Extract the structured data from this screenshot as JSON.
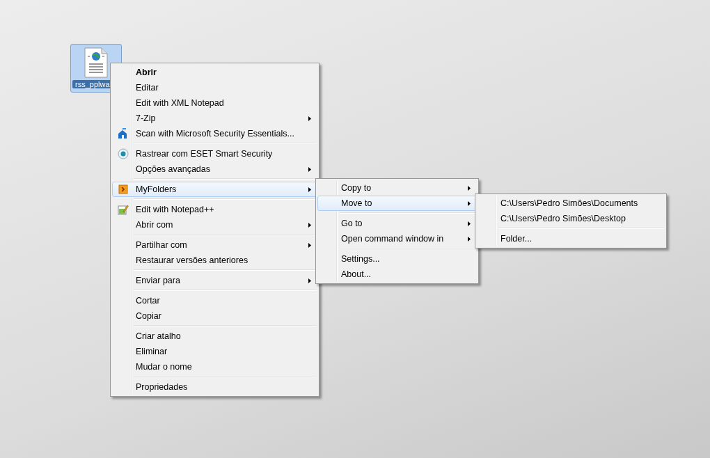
{
  "desktop": {
    "icon": {
      "label": "rss_pplwa",
      "selected": true
    }
  },
  "context_menu": {
    "items": [
      {
        "kind": "item",
        "label": "Abrir",
        "default": true,
        "submenu": false,
        "selected": false
      },
      {
        "kind": "item",
        "label": "Editar",
        "default": false,
        "submenu": false,
        "selected": false
      },
      {
        "kind": "item",
        "label": "Edit with XML Notepad",
        "default": false,
        "submenu": false,
        "selected": false
      },
      {
        "kind": "item",
        "label": "7-Zip",
        "default": false,
        "submenu": true,
        "selected": false
      },
      {
        "kind": "item",
        "label": "Scan with Microsoft Security Essentials...",
        "default": false,
        "submenu": false,
        "selected": false
      },
      {
        "kind": "separator"
      },
      {
        "kind": "item",
        "label": "Rastrear com ESET Smart Security",
        "default": false,
        "submenu": false,
        "selected": false
      },
      {
        "kind": "item",
        "label": "Opções avançadas",
        "default": false,
        "submenu": true,
        "selected": false
      },
      {
        "kind": "separator"
      },
      {
        "kind": "item",
        "label": "MyFolders",
        "default": false,
        "submenu": true,
        "selected": true
      },
      {
        "kind": "separator"
      },
      {
        "kind": "item",
        "label": "Edit with Notepad++",
        "default": false,
        "submenu": false,
        "selected": false
      },
      {
        "kind": "item",
        "label": "Abrir com",
        "default": false,
        "submenu": true,
        "selected": false
      },
      {
        "kind": "separator"
      },
      {
        "kind": "item",
        "label": "Partilhar com",
        "default": false,
        "submenu": true,
        "selected": false
      },
      {
        "kind": "item",
        "label": "Restaurar versões anteriores",
        "default": false,
        "submenu": false,
        "selected": false
      },
      {
        "kind": "separator"
      },
      {
        "kind": "item",
        "label": "Enviar para",
        "default": false,
        "submenu": true,
        "selected": false
      },
      {
        "kind": "separator"
      },
      {
        "kind": "item",
        "label": "Cortar",
        "default": false,
        "submenu": false,
        "selected": false
      },
      {
        "kind": "item",
        "label": "Copiar",
        "default": false,
        "submenu": false,
        "selected": false
      },
      {
        "kind": "separator"
      },
      {
        "kind": "item",
        "label": "Criar atalho",
        "default": false,
        "submenu": false,
        "selected": false
      },
      {
        "kind": "item",
        "label": "Eliminar",
        "default": false,
        "submenu": false,
        "selected": false
      },
      {
        "kind": "item",
        "label": "Mudar o nome",
        "default": false,
        "submenu": false,
        "selected": false
      },
      {
        "kind": "separator"
      },
      {
        "kind": "item",
        "label": "Propriedades",
        "default": false,
        "submenu": false,
        "selected": false
      }
    ]
  },
  "myfolders_submenu": {
    "items": [
      {
        "kind": "item",
        "label": "Copy to",
        "submenu": true,
        "selected": false
      },
      {
        "kind": "item",
        "label": "Move to",
        "submenu": true,
        "selected": true
      },
      {
        "kind": "separator"
      },
      {
        "kind": "item",
        "label": "Go to",
        "submenu": true,
        "selected": false
      },
      {
        "kind": "item",
        "label": "Open command window in",
        "submenu": true,
        "selected": false
      },
      {
        "kind": "separator"
      },
      {
        "kind": "item",
        "label": "Settings...",
        "submenu": false,
        "selected": false
      },
      {
        "kind": "item",
        "label": "About...",
        "submenu": false,
        "selected": false
      }
    ]
  },
  "move_to_submenu": {
    "items": [
      {
        "kind": "item",
        "label": "C:\\Users\\Pedro Simões\\Documents",
        "submenu": false,
        "selected": false
      },
      {
        "kind": "item",
        "label": "C:\\Users\\Pedro Simões\\Desktop",
        "submenu": false,
        "selected": false
      },
      {
        "kind": "separator"
      },
      {
        "kind": "item",
        "label": "Folder...",
        "submenu": false,
        "selected": false
      }
    ]
  }
}
